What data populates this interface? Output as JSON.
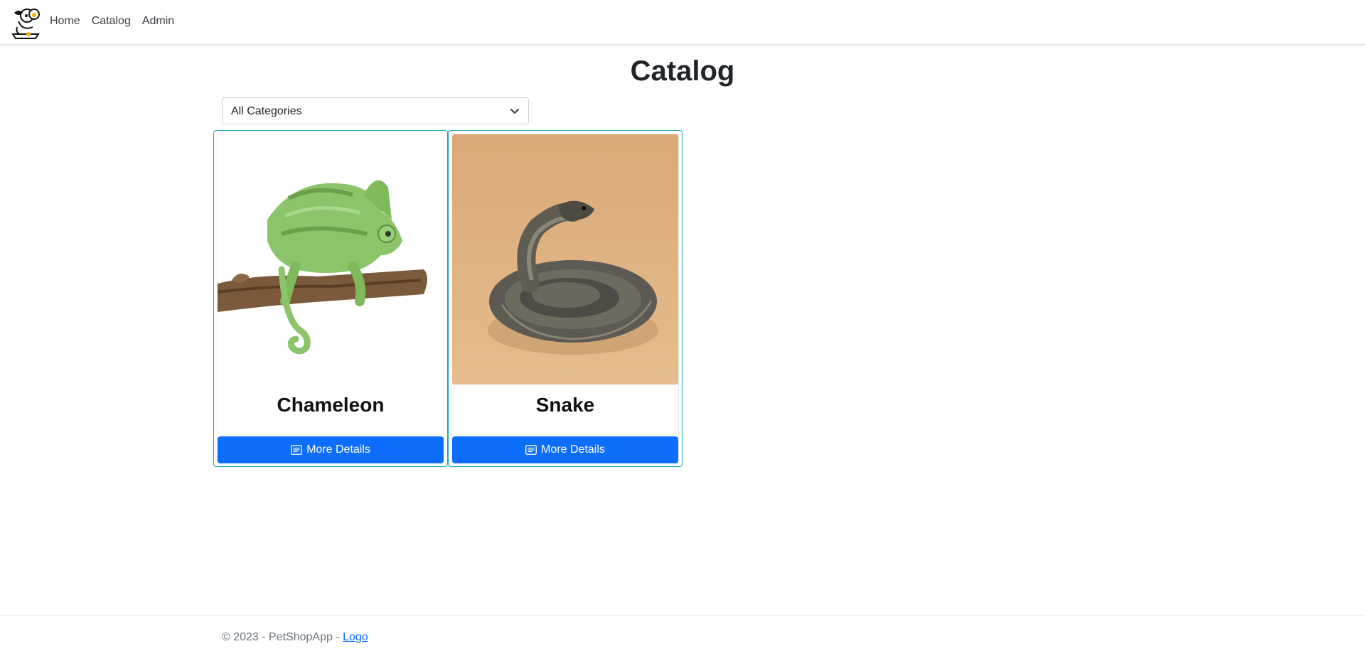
{
  "navbar": {
    "logo_icon": "petshop-logo-icon",
    "links": [
      "Home",
      "Catalog",
      "Admin"
    ]
  },
  "main": {
    "title": "Catalog",
    "category_filter": {
      "selected": "All Categories"
    },
    "products": [
      {
        "name": "Chameleon",
        "button_label": "More Details",
        "image": "chameleon-image"
      },
      {
        "name": "Snake",
        "button_label": "More Details",
        "image": "snake-image"
      }
    ]
  },
  "footer": {
    "text": "© 2023 - PetShopApp - ",
    "link": "Logo"
  },
  "colors": {
    "primary_button": "#0d6efd",
    "card_border": "#17a2b8"
  }
}
